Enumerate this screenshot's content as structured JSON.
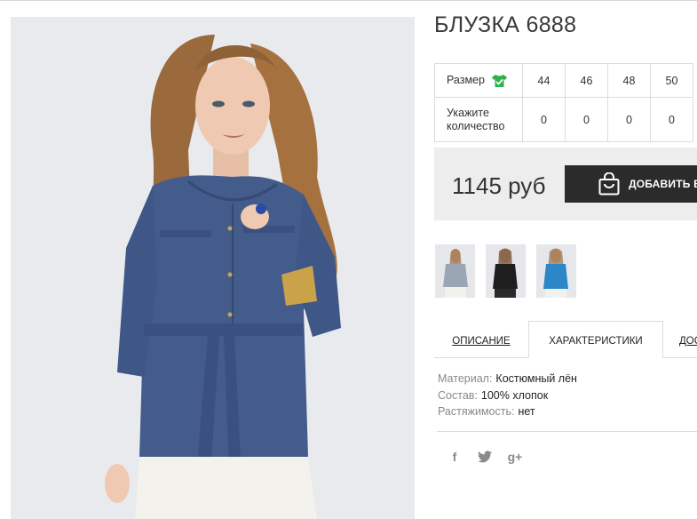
{
  "product": {
    "title": "БЛУЗКА 6888"
  },
  "size_table": {
    "size_label": "Размер",
    "size_icon": "shirt-check-icon",
    "qty_label": "Укажите количество",
    "sizes": [
      "44",
      "46",
      "48",
      "50"
    ],
    "quantities": [
      "0",
      "0",
      "0",
      "0"
    ]
  },
  "purchase": {
    "price": "1145 руб",
    "add_to_cart_label": "ДОБАВИТЬ В З",
    "add_to_cart_icon": "shopping-bag-icon"
  },
  "thumbnails": [
    {
      "name": "thumb-grey-blouse",
      "color": "#9aa6b4"
    },
    {
      "name": "thumb-black-blouse",
      "color": "#1e1e1e"
    },
    {
      "name": "thumb-blue-blouse",
      "color": "#2c86c8"
    }
  ],
  "tabs": {
    "description": "ОПИСАНИЕ",
    "characteristics": "ХАРАКТЕРИСТИКИ",
    "delivery": "ДОС"
  },
  "specs": {
    "material_key": "Материал:",
    "material_val": "Костюмный лён",
    "composition_key": "Состав:",
    "composition_val": "100% хлопок",
    "stretch_key": "Растяжимость:",
    "stretch_val": "нет"
  },
  "social": {
    "facebook": "f",
    "twitter": "t",
    "google": "g+"
  },
  "colors": {
    "accent_green": "#2db34a",
    "button_dark": "#2b2b2b",
    "blouse_blue": "#435c8c"
  }
}
